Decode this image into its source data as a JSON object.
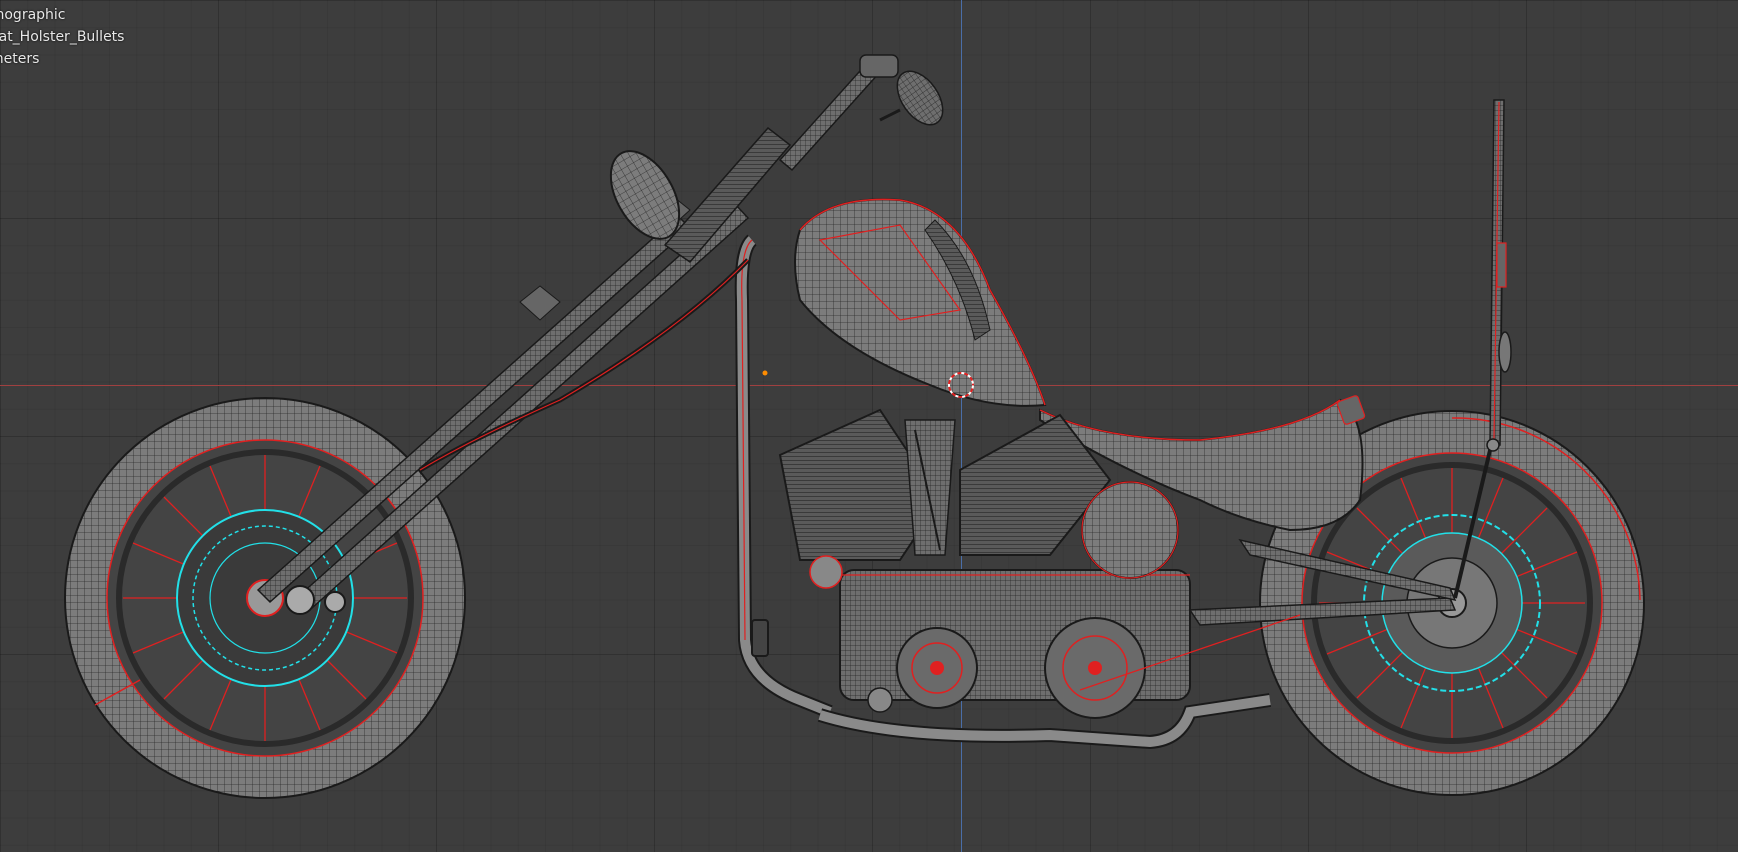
{
  "viewport": {
    "overlay_lines": [
      "thographic",
      "eat_Holster_Bullets",
      "meters"
    ],
    "colors": {
      "background": "#3d3d3d",
      "grid": "#363636",
      "x_axis": "#a04040",
      "z_axis": "#4a6ea8",
      "wire": "#1a1a1a",
      "mesh_fill": "#7a7a7a",
      "seam": "#e02020",
      "selected": "#22e0e8",
      "origin": "#ff8c00"
    },
    "icons": [
      "3d-cursor-icon",
      "object-origin-icon"
    ]
  }
}
